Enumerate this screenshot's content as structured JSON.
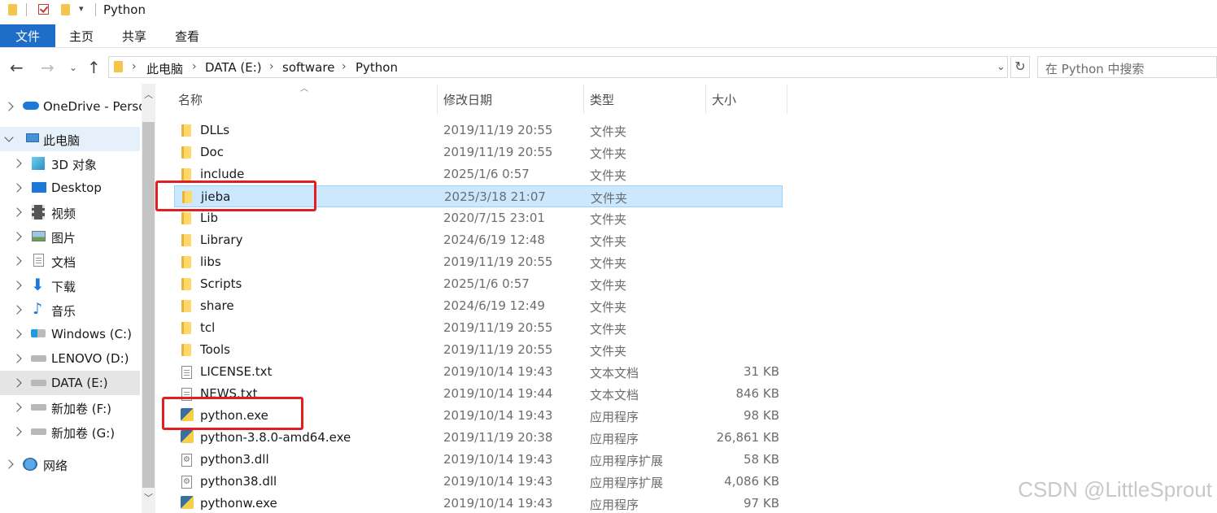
{
  "title": "Python",
  "ribbon": {
    "file": "文件",
    "tabs": [
      "主页",
      "共享",
      "查看"
    ]
  },
  "address": {
    "crumbs": [
      "此电脑",
      "DATA (E:)",
      "software",
      "Python"
    ]
  },
  "search": {
    "placeholder": "在 Python 中搜索"
  },
  "nav": {
    "items": [
      {
        "label": "OneDrive - Perso",
        "icon": "cloud-icon"
      },
      {
        "label": "此电脑",
        "icon": "computer-icon"
      },
      {
        "label": "3D 对象",
        "icon": "cube-icon"
      },
      {
        "label": "Desktop",
        "icon": "desktop-icon"
      },
      {
        "label": "视频",
        "icon": "film-icon"
      },
      {
        "label": "图片",
        "icon": "picture-icon"
      },
      {
        "label": "文档",
        "icon": "document-icon"
      },
      {
        "label": "下载",
        "icon": "download-arrow-icon"
      },
      {
        "label": "音乐",
        "icon": "music-note-icon"
      },
      {
        "label": "Windows (C:)",
        "icon": "windows-drive-icon"
      },
      {
        "label": "LENOVO (D:)",
        "icon": "drive-icon"
      },
      {
        "label": "DATA (E:)",
        "icon": "drive-icon"
      },
      {
        "label": "新加卷 (F:)",
        "icon": "drive-icon"
      },
      {
        "label": "新加卷 (G:)",
        "icon": "drive-icon"
      },
      {
        "label": "网络",
        "icon": "network-icon"
      }
    ]
  },
  "columns": {
    "name": "名称",
    "date": "修改日期",
    "type": "类型",
    "size": "大小"
  },
  "files": [
    {
      "name": "DLLs",
      "date": "2019/11/19 20:55",
      "type": "文件夹",
      "size": "",
      "icon": "folder-icon"
    },
    {
      "name": "Doc",
      "date": "2019/11/19 20:55",
      "type": "文件夹",
      "size": "",
      "icon": "folder-icon"
    },
    {
      "name": "include",
      "date": "2025/1/6 0:57",
      "type": "文件夹",
      "size": "",
      "icon": "folder-icon"
    },
    {
      "name": "jieba",
      "date": "2025/3/18 21:07",
      "type": "文件夹",
      "size": "",
      "icon": "folder-icon"
    },
    {
      "name": "Lib",
      "date": "2020/7/15 23:01",
      "type": "文件夹",
      "size": "",
      "icon": "folder-icon"
    },
    {
      "name": "Library",
      "date": "2024/6/19 12:48",
      "type": "文件夹",
      "size": "",
      "icon": "folder-icon"
    },
    {
      "name": "libs",
      "date": "2019/11/19 20:55",
      "type": "文件夹",
      "size": "",
      "icon": "folder-icon"
    },
    {
      "name": "Scripts",
      "date": "2025/1/6 0:57",
      "type": "文件夹",
      "size": "",
      "icon": "folder-icon"
    },
    {
      "name": "share",
      "date": "2024/6/19 12:49",
      "type": "文件夹",
      "size": "",
      "icon": "folder-icon"
    },
    {
      "name": "tcl",
      "date": "2019/11/19 20:55",
      "type": "文件夹",
      "size": "",
      "icon": "folder-icon"
    },
    {
      "name": "Tools",
      "date": "2019/11/19 20:55",
      "type": "文件夹",
      "size": "",
      "icon": "folder-icon"
    },
    {
      "name": "LICENSE.txt",
      "date": "2019/10/14 19:43",
      "type": "文本文档",
      "size": "31 KB",
      "icon": "text-file-icon"
    },
    {
      "name": "NEWS.txt",
      "date": "2019/10/14 19:44",
      "type": "文本文档",
      "size": "846 KB",
      "icon": "text-file-icon"
    },
    {
      "name": "python.exe",
      "date": "2019/10/14 19:43",
      "type": "应用程序",
      "size": "98 KB",
      "icon": "python-icon"
    },
    {
      "name": "python-3.8.0-amd64.exe",
      "date": "2019/11/19 20:38",
      "type": "应用程序",
      "size": "26,861 KB",
      "icon": "python-installer-icon"
    },
    {
      "name": "python3.dll",
      "date": "2019/10/14 19:43",
      "type": "应用程序扩展",
      "size": "58 KB",
      "icon": "dll-icon"
    },
    {
      "name": "python38.dll",
      "date": "2019/10/14 19:43",
      "type": "应用程序扩展",
      "size": "4,086 KB",
      "icon": "dll-icon"
    },
    {
      "name": "pythonw.exe",
      "date": "2019/10/14 19:43",
      "type": "应用程序",
      "size": "97 KB",
      "icon": "python-icon"
    }
  ],
  "watermark": "CSDN @LittleSprout"
}
